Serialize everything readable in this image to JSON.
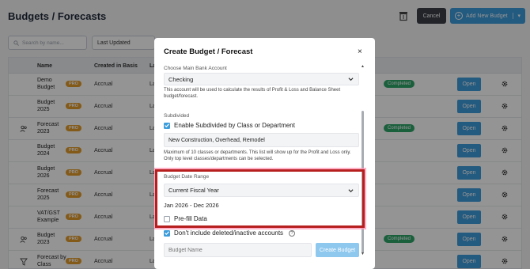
{
  "page": {
    "title": "Budgets / Forecasts",
    "cancel_label": "Cancel",
    "add_new_label": "Add New Budget",
    "search_placeholder": "Search by name...",
    "sort_value": "Last Updated",
    "columns": {
      "name": "Name",
      "basis": "Created in Basis",
      "la": "La"
    },
    "open_label": "Open",
    "pro_label": "PRO",
    "rows": [
      {
        "name": "Demo Budget",
        "basis": "Accrual",
        "la": "La",
        "status": "Completed",
        "left_icon": ""
      },
      {
        "name": "Budget 2025",
        "basis": "Accrual",
        "la": "La",
        "status": "",
        "left_icon": ""
      },
      {
        "name": "Forecast 2023",
        "basis": "Accrual",
        "la": "La",
        "status": "Completed",
        "left_icon": "users-icon"
      },
      {
        "name": "Budget 2024",
        "basis": "Accrual",
        "la": "La",
        "status": "",
        "left_icon": ""
      },
      {
        "name": "Budget 2026",
        "basis": "Accrual",
        "la": "La",
        "status": "",
        "left_icon": ""
      },
      {
        "name": "Forecast 2025",
        "basis": "Accrual",
        "la": "La",
        "status": "",
        "left_icon": ""
      },
      {
        "name": "VAT/GST Example",
        "basis": "Accrual",
        "la": "La",
        "status": "",
        "left_icon": ""
      },
      {
        "name": "Budget 2023",
        "basis": "Accrual",
        "la": "La",
        "status": "Completed",
        "left_icon": "users-icon"
      },
      {
        "name": "Forecast by Class",
        "basis": "Accrual",
        "la": "La",
        "status": "",
        "left_icon": "filter-icon"
      }
    ]
  },
  "modal": {
    "title": "Create Budget / Forecast",
    "close": "×",
    "bank_label": "Choose Main Bank Account",
    "bank_value": "Checking",
    "bank_help": "This account will be used to calculate the results of Profit & Loss and Balance Sheet budget/forecast.",
    "subdivided_label": "Subdivided",
    "subdivided_check": "Enable Subdivided by Class or Department",
    "subdivided_value": "New Construction, Overhead, Remodel",
    "subdivided_help": "Maximum of 10 classes or departments. This list will show up for the Profit and Loss only. Only top level classes/departments can be selected.",
    "date_range_label": "Budget Date Range",
    "date_range_value": "Current Fiscal Year",
    "date_range_text": "Jan 2026 - Dec 2026",
    "prefill_label": "Pre-fill Data",
    "exclude_label": "Don't include deleted/inactive accounts",
    "info_glyph": "?",
    "name_placeholder": "Budget Name",
    "create_label": "Create Budget"
  },
  "colors": {
    "primary": "#3d9cdb",
    "pro": "#e39b2a",
    "completed": "#2fa56a",
    "highlight": "#b71f1f"
  }
}
